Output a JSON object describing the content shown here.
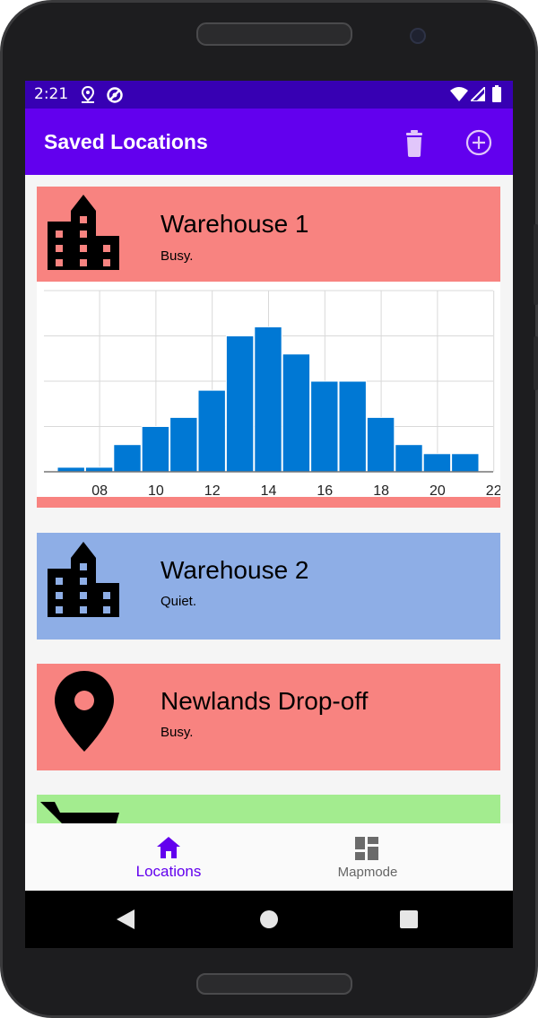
{
  "status_bar": {
    "time": "2:21",
    "icons": [
      "location-pin-icon",
      "sync-icon",
      "wifi-icon",
      "signal-icon",
      "battery-icon"
    ]
  },
  "app_bar": {
    "title": "Saved Locations",
    "actions": [
      "trash-icon",
      "add-circle-icon"
    ]
  },
  "colors": {
    "busy": "#f88380",
    "quiet": "#8eaee6",
    "green": "#a3ec8f",
    "primary": "#6200ee",
    "status_bar": "#3700b3",
    "bar": "#0078d4"
  },
  "locations": [
    {
      "name": "Warehouse 1",
      "status": "Busy.",
      "icon": "building-icon",
      "color": "#f88380",
      "expanded": true
    },
    {
      "name": "Warehouse 2",
      "status": "Quiet.",
      "icon": "building-icon",
      "color": "#8eaee6",
      "expanded": false
    },
    {
      "name": "Newlands Drop-off",
      "status": "Busy.",
      "icon": "map-pin-icon",
      "color": "#f88380",
      "expanded": false
    },
    {
      "name": "",
      "status": "",
      "icon": "shopping-cart-icon",
      "color": "#a3ec8f",
      "expanded": false
    }
  ],
  "chart_data": {
    "type": "bar",
    "categories": [
      "07",
      "08",
      "09",
      "10",
      "11",
      "12",
      "13",
      "14",
      "15",
      "16",
      "17",
      "18",
      "19",
      "20",
      "21",
      "22",
      "23"
    ],
    "values": [
      0.5,
      0.5,
      3,
      5,
      6,
      9,
      15,
      16,
      13,
      10,
      10,
      6,
      3,
      2,
      2,
      0,
      0
    ],
    "tick_labels": [
      "08",
      "10",
      "12",
      "14",
      "16",
      "18",
      "20",
      "22"
    ],
    "title": "",
    "xlabel": "",
    "ylabel": "",
    "ylim": [
      0,
      20
    ],
    "grid": true
  },
  "bottom_nav": {
    "items": [
      {
        "label": "Locations",
        "icon": "home-icon",
        "active": true
      },
      {
        "label": "Mapmode",
        "icon": "dashboard-icon",
        "active": false
      }
    ]
  },
  "system_nav": [
    "back-icon",
    "home-circle-icon",
    "recents-icon"
  ]
}
